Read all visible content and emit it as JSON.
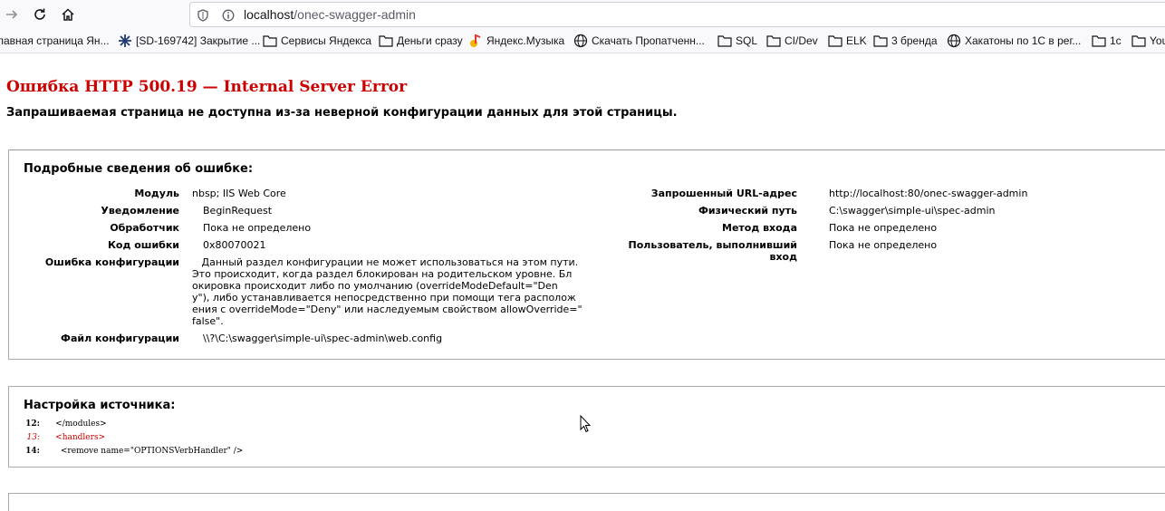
{
  "browser": {
    "url_host": "localhost",
    "url_path": "/onec-swagger-admin",
    "nav_icons": [
      "forward-arrow-icon",
      "reload-icon",
      "home-icon"
    ],
    "url_icons": [
      "shield-icon",
      "info-icon"
    ]
  },
  "bookmarks": [
    {
      "label": "лавная страница Ян...",
      "icon": "none"
    },
    {
      "label": "[SD-169742] Закрытие ...",
      "icon": "jira-icon"
    },
    {
      "label": "Сервисы Яндекса",
      "icon": "folder-icon"
    },
    {
      "label": "Деньги сразу",
      "icon": "folder-icon"
    },
    {
      "label": "Яндекс.Музыка",
      "icon": "yandex-music-icon"
    },
    {
      "label": "Скачать Пропатченн...",
      "icon": "globe-icon"
    },
    {
      "label": "SQL",
      "icon": "folder-icon"
    },
    {
      "label": "CI/Dev",
      "icon": "folder-icon"
    },
    {
      "label": "ELK",
      "icon": "folder-icon"
    },
    {
      "label": "3 бренда",
      "icon": "folder-icon"
    },
    {
      "label": "Хакатоны по 1С в рег...",
      "icon": "globe-icon"
    },
    {
      "label": "1c",
      "icon": "folder-icon"
    },
    {
      "label": "You",
      "icon": "folder-icon"
    }
  ],
  "error": {
    "title": "Ошибка HTTP 500.19 — Internal Server Error",
    "subtitle": "Запрашиваемая страница не доступна из-за неверной конфигурации данных для этой страницы.",
    "details_heading": "Подробные сведения об ошибке:",
    "left_fields": [
      {
        "label": "Модуль",
        "value": "nbsp;  IIS Web Core"
      },
      {
        "label": "Уведомление",
        "value": "BeginRequest"
      },
      {
        "label": "Обработчик",
        "value": "Пока не определено"
      },
      {
        "label": "Код ошибки",
        "value": "0x80070021"
      },
      {
        "label": "Ошибка конфигурации",
        "value": "   Данный раздел конфигурации не может использоваться на этом пути.\nЭто происходит, когда раздел блокирован на родительском уровне. Бл\nокировка происходит либо по умолчанию (overrideModeDefault=\"Den\ny\"), либо устанавливается непосредственно при помощи тега располож\nения с overrideMode=\"Deny\" или наследуемым свойством allowOverride=\"\nfalse\"."
      },
      {
        "label": "Файл конфигурации",
        "value": "\\\\?\\C:\\swagger\\simple-ui\\spec-admin\\web.config"
      }
    ],
    "right_fields": [
      {
        "label": "Запрошенный URL-адрес",
        "value": "http://localhost:80/onec-swagger-admin"
      },
      {
        "label": "Физический путь",
        "value": "C:\\swagger\\simple-ui\\spec-admin"
      },
      {
        "label": "Метод входа",
        "value": "Пока не определено"
      },
      {
        "label": "Пользователь, выполнивший\nвход",
        "value": "Пока не определено"
      }
    ],
    "source_heading": "Настройка источника:",
    "source_lines": [
      {
        "num": "12:",
        "code": "</modules>",
        "highlight": false
      },
      {
        "num": "13:",
        "code": "<handlers>",
        "highlight": true
      },
      {
        "num": "14:",
        "code": "  <remove name=\"OPTIONSVerbHandler\" />",
        "highlight": false
      }
    ]
  },
  "colors": {
    "error_red": "#cc0000",
    "border": "#aaaaaa"
  }
}
